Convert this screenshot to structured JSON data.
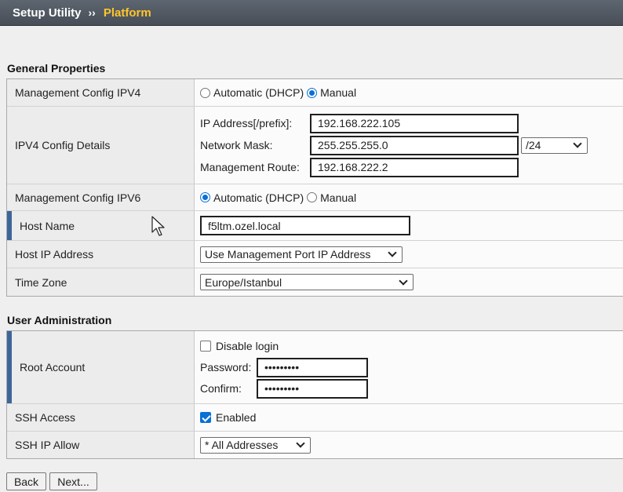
{
  "breadcrumb": {
    "parent": "Setup Utility",
    "separator": "››",
    "current": "Platform"
  },
  "general": {
    "title": "General Properties",
    "mgmt_ipv4": {
      "label": "Management Config IPV4",
      "opt_auto": "Automatic (DHCP)",
      "opt_manual": "Manual",
      "selected": "Manual"
    },
    "ipv4_details": {
      "label": "IPV4 Config Details",
      "ip_label": "IP Address[/prefix]:",
      "ip_value": "192.168.222.105",
      "mask_label": "Network Mask:",
      "mask_value": "255.255.255.0",
      "prefix_value": "/24",
      "route_label": "Management Route:",
      "route_value": "192.168.222.2"
    },
    "mgmt_ipv6": {
      "label": "Management Config IPV6",
      "opt_auto": "Automatic (DHCP)",
      "opt_manual": "Manual",
      "selected": "Automatic (DHCP)"
    },
    "host_name": {
      "label": "Host Name",
      "value": "f5ltm.ozel.local"
    },
    "host_ip": {
      "label": "Host IP Address",
      "value": "Use Management Port IP Address"
    },
    "time_zone": {
      "label": "Time Zone",
      "value": "Europe/Istanbul"
    }
  },
  "user_admin": {
    "title": "User Administration",
    "root": {
      "label": "Root Account",
      "disable_label": "Disable login",
      "disable_checked": false,
      "password_label": "Password:",
      "password_value": "•••••••••",
      "confirm_label": "Confirm:",
      "confirm_value": "•••••••••"
    },
    "ssh_access": {
      "label": "SSH Access",
      "enabled_label": "Enabled",
      "checked": true
    },
    "ssh_ip_allow": {
      "label": "SSH IP Allow",
      "value": "* All Addresses"
    }
  },
  "buttons": {
    "back": "Back",
    "next": "Next..."
  },
  "colors": {
    "header_bg": "#4e5660",
    "breadcrumb_current": "#ffc62a",
    "required_marker": "#3d6699",
    "radio_accent": "#0a6fd6"
  },
  "icons": [
    "chevron-down-icon",
    "mouse-pointer-icon"
  ]
}
